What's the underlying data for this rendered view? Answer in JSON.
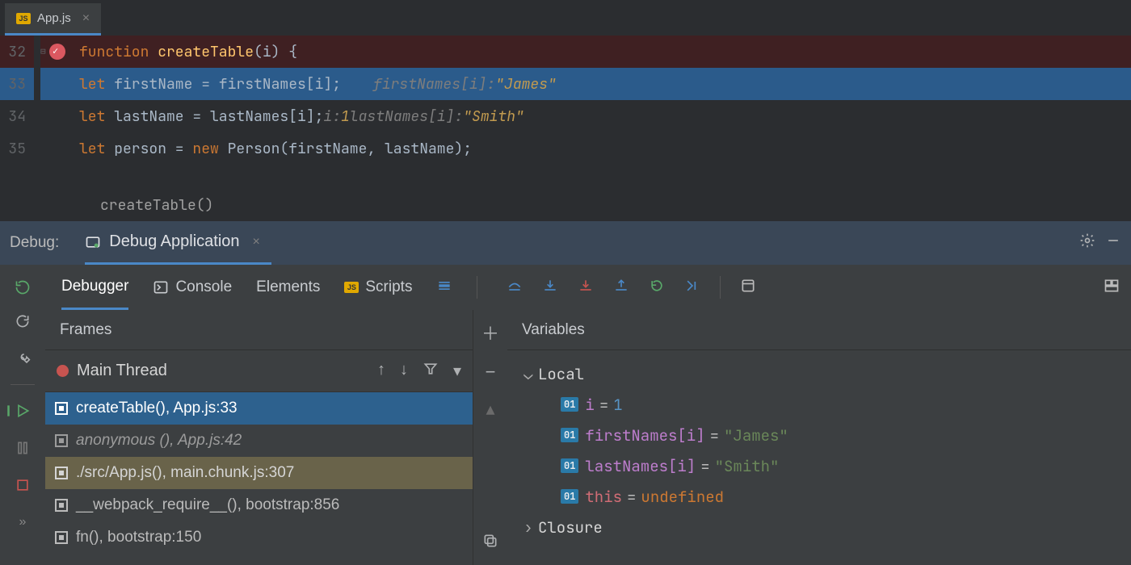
{
  "fileTab": {
    "name": "App.js",
    "iconText": "JS"
  },
  "code": {
    "lines": [
      {
        "num": "32",
        "html": "<span class='kw'>function </span><span class='fn'>createTable</span><span class='id'>(i) {</span>",
        "breakpoint": true
      },
      {
        "num": "33",
        "html": "    <span class='kw'>let </span><span class='id'>firstName = firstNames[i];</span>",
        "hint": "firstNames[i]: \"James\"",
        "highlight": true
      },
      {
        "num": "34",
        "html": "    <span class='kw'>let </span><span class='id'>lastName = lastNames[i];</span>",
        "hint2": "i: 1      lastNames[i]: \"Smith\""
      },
      {
        "num": "35",
        "html": "    <span class='kw'>let </span><span class='id'>person = </span><span class='kw'>new </span><span class='id'>Person(firstName, lastName);</span>"
      }
    ],
    "breadcrumb": "createTable()"
  },
  "debugHeader": {
    "label": "Debug:",
    "config": "Debug Application"
  },
  "debugTabs": {
    "tabs": [
      "Debugger",
      "Console",
      "Elements",
      "Scripts"
    ],
    "active": 0
  },
  "frames": {
    "title": "Frames",
    "thread": "Main Thread",
    "items": [
      {
        "text": "createTable(), App.js:33",
        "sel": "blue"
      },
      {
        "text": "anonymous (), App.js:42",
        "ital": true
      },
      {
        "text": "./src/App.js(), main.chunk.js:307",
        "sel": "gold"
      },
      {
        "text": "__webpack_require__(), bootstrap:856"
      },
      {
        "text": "fn(), bootstrap:150"
      }
    ]
  },
  "variables": {
    "title": "Variables",
    "scopes": [
      {
        "name": "Local",
        "expanded": true,
        "vars": [
          {
            "name": "i",
            "value": "1",
            "type": "num"
          },
          {
            "name": "firstNames[i]",
            "value": "\"James\"",
            "type": "str"
          },
          {
            "name": "lastNames[i]",
            "value": "\"Smith\"",
            "type": "str"
          },
          {
            "name": "this",
            "value": "undefined",
            "type": "und",
            "this": true
          }
        ]
      },
      {
        "name": "Closure",
        "expanded": false
      }
    ]
  }
}
